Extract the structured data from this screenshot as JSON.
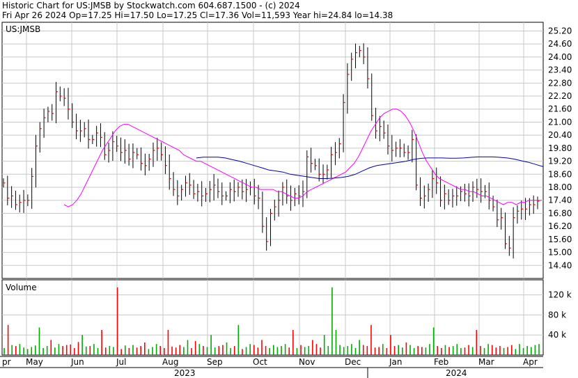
{
  "header": {
    "line1": "Historic Chart for US:JMSB by Stockwatch.com 604.687.1500 - (c) 2024",
    "line2": "Fri Apr 26 2024  Op=17.25  Hi=17.50  Lo=17.25  Cl=17.36  Vol=11,593  Year hi=24.84  lo=14.38"
  },
  "colors": {
    "background": "#ffffff",
    "grid": "#c8c8c8",
    "price_bar": "#000000",
    "close_tick": "#ff0000",
    "ma_short": "#ff00ff",
    "ma_long": "#0000aa",
    "vol_up": "#00aa00",
    "vol_down": "#ff0000"
  },
  "chart_data": {
    "type": "line",
    "symbol_label": "US:JMSB",
    "price_axis": {
      "ticks": [
        "25.20",
        "24.60",
        "24.00",
        "23.40",
        "22.80",
        "22.20",
        "21.60",
        "21.00",
        "20.40",
        "19.80",
        "19.20",
        "18.60",
        "18.00",
        "17.40",
        "16.80",
        "16.20",
        "15.60",
        "15.00",
        "14.40"
      ],
      "range": [
        13.8,
        25.6
      ]
    },
    "volume_panel": {
      "title": "Volume",
      "ticks": [
        "120 k",
        "80 k",
        "40 k"
      ],
      "range": [
        0,
        150000
      ]
    },
    "month_labels": [
      "pr",
      "May",
      "Jun",
      "Jul",
      "Aug",
      "Sep",
      "Oct",
      "Nov",
      "Dec",
      "Jan",
      "Feb",
      "Mar",
      "Apr"
    ],
    "year_labels": [
      "2023",
      "2024"
    ],
    "date_range": [
      "2023-04-26",
      "2024-04-26"
    ],
    "last_bar": {
      "open": 17.25,
      "high": 17.5,
      "low": 17.25,
      "close": 17.36,
      "volume": 11593
    },
    "close_series": [
      18.2,
      17.5,
      17.6,
      17.2,
      17.3,
      17.4,
      17.4,
      18.5,
      19.9,
      20.7,
      21.2,
      21.5,
      21.4,
      22.4,
      22.2,
      22.1,
      21.6,
      21.0,
      20.6,
      20.6,
      20.7,
      20.2,
      20.2,
      20.5,
      20.3,
      19.5,
      19.7,
      20.1,
      19.9,
      19.6,
      19.7,
      19.3,
      19.6,
      19.5,
      19.1,
      19.0,
      19.3,
      19.7,
      19.8,
      19.5,
      19.0,
      18.4,
      17.9,
      17.6,
      17.9,
      18.2,
      18.1,
      17.7,
      17.8,
      17.6,
      17.7,
      17.9,
      18.1,
      17.8,
      17.6,
      17.6,
      17.9,
      17.8,
      18.0,
      17.8,
      17.9,
      18.0,
      17.6,
      17.5,
      16.2,
      15.5,
      16.8,
      17.1,
      17.4,
      18.0,
      17.6,
      17.4,
      17.7,
      17.6,
      17.8,
      19.4,
      19.1,
      19.0,
      18.6,
      18.6,
      18.8,
      19.5,
      19.6,
      20.0,
      21.9,
      23.2,
      23.9,
      24.2,
      24.3,
      24.0,
      23.0,
      21.3,
      20.6,
      20.8,
      20.5,
      19.9,
      19.7,
      19.8,
      19.8,
      19.6,
      19.6,
      20.2,
      18.1,
      17.5,
      17.6,
      17.9,
      18.4,
      18.2,
      17.4,
      17.7,
      17.4,
      17.6,
      17.6,
      17.8,
      17.7,
      17.6,
      18.0,
      17.9,
      17.8,
      17.8,
      17.4,
      17.1,
      16.5,
      16.6,
      15.4,
      15.2,
      16.6,
      16.9,
      17.0,
      17.0,
      17.2,
      17.2,
      17.36
    ],
    "ma_short_series": [
      17.2,
      17.1,
      17.2,
      17.4,
      17.7,
      18.1,
      18.5,
      18.9,
      19.3,
      19.7,
      20.0,
      20.3,
      20.6,
      20.8,
      20.9,
      20.9,
      20.8,
      20.7,
      20.6,
      20.5,
      20.4,
      20.3,
      20.2,
      20.1,
      20.0,
      19.9,
      19.8,
      19.7,
      19.5,
      19.4,
      19.3,
      19.2,
      19.2,
      19.1,
      19.0,
      18.9,
      18.8,
      18.7,
      18.6,
      18.5,
      18.4,
      18.3,
      18.2,
      18.1,
      18.0,
      18.0,
      17.9,
      17.9,
      17.9,
      17.9,
      17.8,
      17.8,
      17.7,
      17.6,
      17.5,
      17.5,
      17.6,
      17.8,
      17.9,
      18.0,
      18.1,
      18.2,
      18.3,
      18.4,
      18.5,
      18.6,
      18.7,
      18.9,
      19.1,
      19.4,
      19.8,
      20.2,
      20.6,
      20.9,
      21.2,
      21.4,
      21.5,
      21.6,
      21.6,
      21.5,
      21.3,
      21.0,
      20.6,
      20.1,
      19.6,
      19.2,
      18.9,
      18.6,
      18.4,
      18.3,
      18.2,
      18.1,
      18.0,
      17.9,
      17.9,
      17.8,
      17.8,
      17.7,
      17.6,
      17.6,
      17.5,
      17.4,
      17.3,
      17.2,
      17.3,
      17.3,
      17.2,
      17.3,
      17.3,
      17.4,
      17.4,
      17.4,
      17.4
    ],
    "ma_long_series": [
      19.35,
      19.39,
      19.39,
      19.39,
      19.35,
      19.27,
      19.2,
      19.1,
      19.0,
      18.9,
      18.8,
      18.75,
      18.7,
      18.6,
      18.55,
      18.5,
      18.45,
      18.4,
      18.4,
      18.42,
      18.45,
      18.5,
      18.6,
      18.75,
      18.9,
      19.0,
      19.05,
      19.1,
      19.15,
      19.2,
      19.28,
      19.33,
      19.35,
      19.35,
      19.35,
      19.34,
      19.34,
      19.35,
      19.38,
      19.4,
      19.4,
      19.4,
      19.38,
      19.35,
      19.3,
      19.22,
      19.15,
      19.05,
      18.95
    ],
    "volume_series": [
      14,
      60,
      20,
      18,
      22,
      15,
      12,
      16,
      19,
      55,
      14,
      18,
      30,
      15,
      22,
      18,
      20,
      21,
      14,
      26,
      40,
      17,
      18,
      22,
      14,
      50,
      15,
      18,
      16,
      135,
      12,
      19,
      14,
      20,
      15,
      18,
      25,
      12,
      16,
      22,
      18,
      14,
      50,
      17,
      15,
      20,
      16,
      30,
      14,
      28,
      22,
      18,
      16,
      40,
      15,
      18,
      20,
      25,
      14,
      18,
      60,
      12,
      16,
      22,
      20,
      15,
      30,
      18,
      14,
      20,
      16,
      18,
      22,
      15,
      50,
      14,
      20,
      16,
      18,
      30,
      22,
      15,
      40,
      18,
      135,
      50,
      20,
      16,
      18,
      22,
      14,
      30,
      20,
      18,
      60,
      15,
      16,
      22,
      14,
      40,
      18,
      20,
      15,
      25,
      20,
      14,
      18,
      16,
      15,
      22,
      55,
      18,
      14,
      20,
      16,
      18,
      22,
      14,
      15,
      20,
      16,
      50,
      18,
      14,
      22,
      20,
      15,
      18,
      14,
      16,
      20,
      12,
      22,
      14,
      18,
      16,
      20,
      22
    ]
  }
}
